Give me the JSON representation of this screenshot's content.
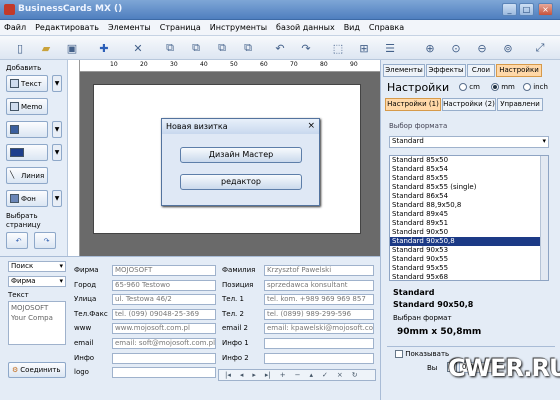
{
  "window": {
    "title": "BusinessCards MX ()"
  },
  "menu": [
    "Файл",
    "Редактировать",
    "Элементы",
    "Страница",
    "Инструменты",
    "базой данных",
    "Вид",
    "Справка"
  ],
  "left": {
    "add_label": "Добавить",
    "buttons": [
      "Текст",
      "Memo",
      "",
      "",
      "Линия",
      "Фон"
    ],
    "choose_page": "Выбрать страницу"
  },
  "ruler": [
    "10",
    "20",
    "30",
    "40",
    "50",
    "60",
    "70",
    "80",
    "90"
  ],
  "dialog": {
    "title": "Новая визитка",
    "btn1": "Дизайн Мастер",
    "btn2": "редактор"
  },
  "right": {
    "tabs": [
      "Элементы",
      "Эффекты",
      "Слои",
      "Настройки"
    ],
    "heading": "Настройки",
    "units": [
      "cm",
      "mm",
      "inch"
    ],
    "subtabs": [
      "Настройки (1)",
      "Настройки (2)",
      "Управлени"
    ],
    "format_label": "Выбор формата",
    "format_select": "Standard",
    "formats": [
      "Standard 85x50",
      "Standard 85x54",
      "Standard 85x55",
      "Standard 85x55 (single)",
      "Standard 86x54",
      "Standard 88,9x50,8",
      "Standard 89x45",
      "Standard 89x51",
      "Standard 90x50",
      "Standard 90x50,8",
      "Standard 90x53",
      "Standard 90x55",
      "Standard 95x55",
      "Standard 95x68"
    ],
    "selected_index": 9,
    "info1": "Standard",
    "info2": "Standard 90x50,8",
    "chosen_label": "Выбран формат",
    "chosen_value": "90mm x 50,8mm",
    "show_label": "Показывать",
    "b_label": "Вы",
    "num_value": "0,000"
  },
  "bottom": {
    "search_label": "Поиск",
    "firm_label": "Фирма",
    "text_label": "Текст",
    "memo": [
      "MOJOSOFT",
      "Your Compa"
    ],
    "connect": "Соединить",
    "fields_left": [
      {
        "label": "Фирма",
        "value": "MOJOSOFT"
      },
      {
        "label": "Город",
        "value": "65-960 Testowo"
      },
      {
        "label": "Улица",
        "value": "ul. Testowa 46/2"
      },
      {
        "label": "Тел.Факс",
        "value": "tel. (099) 09048-25-369"
      },
      {
        "label": "www",
        "value": "www.mojosoft.com.pl"
      },
      {
        "label": "email",
        "value": "email: soft@mojosoft.com.pl"
      },
      {
        "label": "Инфо",
        "value": ""
      },
      {
        "label": "logo",
        "value": ""
      }
    ],
    "fields_right": [
      {
        "label": "Фамилия",
        "value": "Krzysztof Pawelski"
      },
      {
        "label": "Позиция",
        "value": "sprzedawca konsultant"
      },
      {
        "label": "Тел. 1",
        "value": "tel. kom. +989 969 969 857"
      },
      {
        "label": "Тел. 2",
        "value": "tel. (0899) 989-299-596"
      },
      {
        "label": "email 2",
        "value": "email: kpawelski@mojosoft.com.pl"
      },
      {
        "label": "Инфо 1",
        "value": ""
      },
      {
        "label": "Инфо 2",
        "value": ""
      }
    ]
  },
  "watermark": "CWER.RU"
}
